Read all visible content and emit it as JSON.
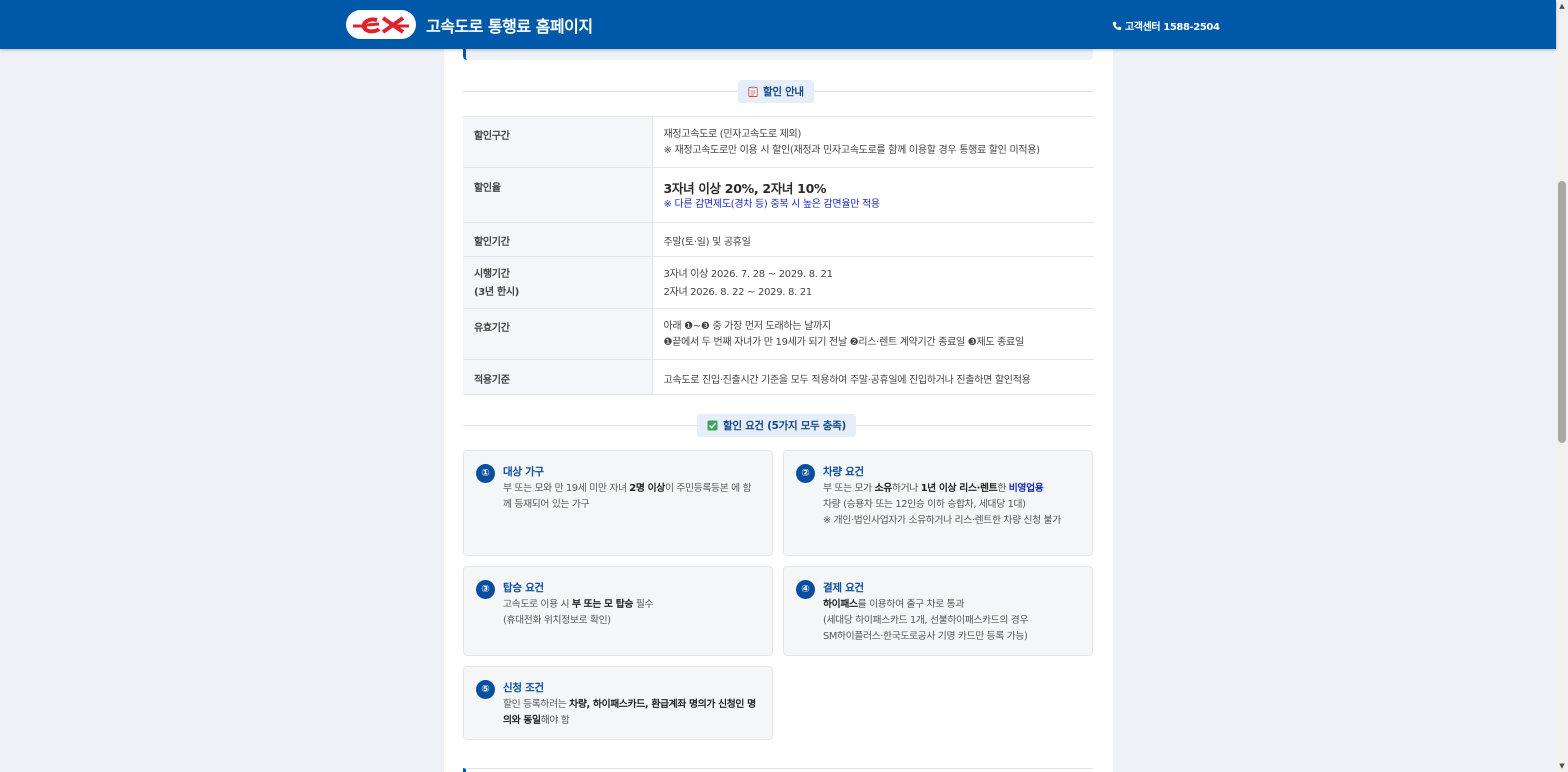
{
  "header": {
    "logo_text": "ex",
    "site_title": "고속도로 통행료 홈페이지",
    "contact_label": "고객센터 1588-2504",
    "phone_icon": "phone-icon"
  },
  "discount_info": {
    "heading": "할인 안내",
    "heading_icon": "clipboard-icon",
    "rows": [
      {
        "label": "할인구간",
        "lines": [
          "재정고속도로 (민자고속도로 제외)",
          "※ 재정고속도로만 이용 시 할인(재정과 민자고속도로를 함께 이용할 경우 통행료 할인 미적용)"
        ]
      },
      {
        "label": "할인율",
        "emphasis": "3자녀 이상 20%, 2자녀 10%",
        "note": "※ 다른 감면제도(경차 등) 중복 시 높은 감면율만 적용"
      },
      {
        "label": "할인기간",
        "lines": [
          "주말(토·일) 및 공휴일"
        ]
      },
      {
        "label": "시행기간",
        "label_sub": "(3년 한시)",
        "lines": [
          "3자녀 이상 2026. 7. 28 ~ 2029. 8. 21",
          "2자녀 2026. 8. 22 ~ 2029. 8. 21"
        ]
      },
      {
        "label": "유효기간",
        "lines": [
          "아래 ❶~❸ 중 가장 먼저 도래하는 날까지",
          "❶끝에서 두 번째 자녀가 만 19세가 되기 전날 ❷리스·렌트 계약기간 종료일 ❸제도 종료일"
        ]
      },
      {
        "label": "적용기준",
        "lines": [
          "고속도로 진입·진출시간 기준을 모두 적용하여 주말·공휴일에 진입하거나 진출하면 할인적용"
        ]
      }
    ]
  },
  "requirements": {
    "heading": "할인 요건 (5가지 모두 충족)",
    "heading_icon": "check-box-icon",
    "cards": [
      {
        "num": "①",
        "title": "대상 가구",
        "t1": "부 또는 모와 만 19세 미만 자녀 ",
        "b1": "2명 이상",
        "t2": "이 주민등록등본 에 함께 등재되어 있는 가구"
      },
      {
        "num": "②",
        "title": "차량 요건",
        "t1": "부 또는 모가 ",
        "b1": "소유",
        "t2": "하거나 ",
        "b2": "1년 이상 리스·렌트",
        "t3": "한 ",
        "b3": "비영업용",
        "line2": "차량 (승용차 또는 12인승 이하 승합차, 세대당 1대)",
        "line3": "※ 개인·법인사업자가 소유하거나 리스·렌트한 차량 신청 불가"
      },
      {
        "num": "③",
        "title": "탑승 요건",
        "t1": "고속도로 이용 시 ",
        "b1": "부 또는 모 탑승",
        "t2": " 필수",
        "line2": "(휴대전화 위치정보로 확인)"
      },
      {
        "num": "④",
        "title": "결제 요건",
        "b1": "하이패스",
        "t1": "를 이용하여 출구 차로 통과",
        "line2": "(세대당 하이패스카드 1개, 선불하이패스카드의 경우",
        "line3": "SM하이플러스·한국도로공사 기명 카드만 등록 가능)"
      },
      {
        "num": "⑤",
        "title": "신청 조건",
        "t1": "할인 등록하려는 ",
        "b1": "차량, 하이패스카드, 환급계좌 명의가 신청인 명의와 동일",
        "t2": "해야 함"
      }
    ]
  },
  "colors": {
    "brand": "#0058a8",
    "accent_blue": "#1b2bb8",
    "logo_red": "#e0202a"
  }
}
